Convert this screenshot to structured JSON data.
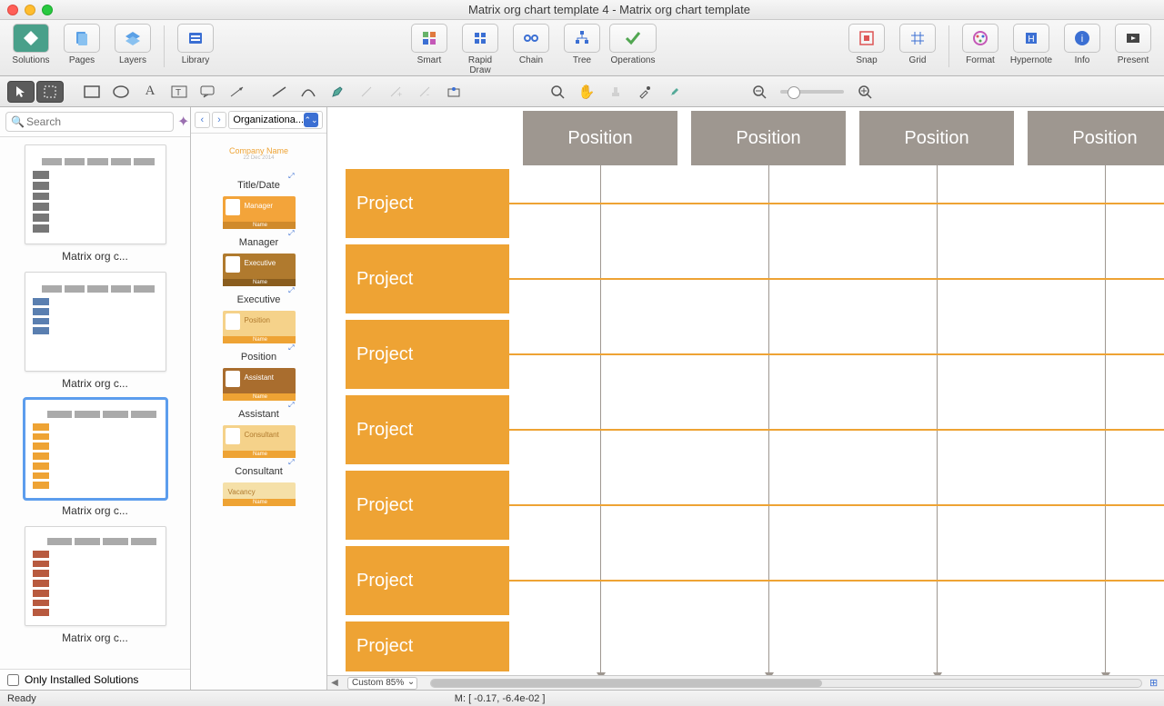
{
  "window": {
    "title": "Matrix org chart template 4 - Matrix org chart template"
  },
  "toolbar": {
    "solutions": "Solutions",
    "pages": "Pages",
    "layers": "Layers",
    "library": "Library",
    "smart": "Smart",
    "rapid": "Rapid Draw",
    "chain": "Chain",
    "tree": "Tree",
    "operations": "Operations",
    "snap": "Snap",
    "grid": "Grid",
    "format": "Format",
    "hypernote": "Hypernote",
    "info": "Info",
    "present": "Present"
  },
  "search": {
    "placeholder": "Search"
  },
  "solutions_panel": {
    "items": [
      {
        "label": "Matrix org c..."
      },
      {
        "label": "Matrix org c..."
      },
      {
        "label": "Matrix org c...",
        "selected": true
      },
      {
        "label": "Matrix org c..."
      }
    ],
    "only_installed": "Only Installed Solutions"
  },
  "library_panel": {
    "selector": "Organizationa...",
    "items": [
      {
        "kind": "title",
        "label": "Title/Date",
        "company": "Company Name",
        "date": "22 Dec 2014"
      },
      {
        "kind": "card",
        "label": "Manager",
        "role": "Manager",
        "name": "Name"
      },
      {
        "kind": "card",
        "label": "Executive",
        "role": "Executive",
        "name": "Name"
      },
      {
        "kind": "card",
        "label": "Position",
        "role": "Position",
        "name": "Name"
      },
      {
        "kind": "card",
        "label": "Assistant",
        "role": "Assistant",
        "name": "Name"
      },
      {
        "kind": "card",
        "label": "Consultant",
        "role": "Consultant",
        "name": "Name"
      },
      {
        "kind": "card",
        "label": "",
        "role": "Vacancy",
        "name": "Name"
      }
    ]
  },
  "canvas": {
    "positions": [
      "Position",
      "Position",
      "Position",
      "Position"
    ],
    "projects": [
      "Project",
      "Project",
      "Project",
      "Project",
      "Project",
      "Project",
      "Project"
    ],
    "zoom_label": "Custom 85%"
  },
  "status": {
    "ready": "Ready",
    "mouse": "M: [ -0.17, -6.4e-02 ]"
  }
}
